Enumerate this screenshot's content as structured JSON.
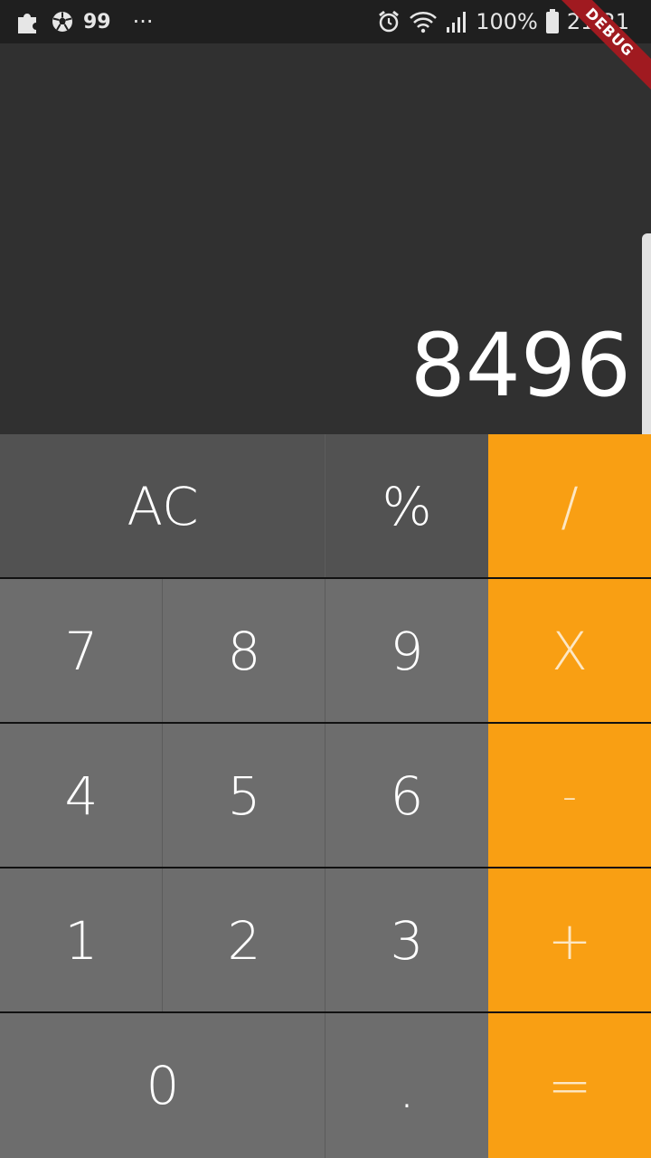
{
  "status_bar": {
    "notification_count": "99",
    "more": "···",
    "battery": "100%",
    "time": "21:21"
  },
  "ribbon": {
    "label": "DEBUG"
  },
  "display": {
    "value": "8496"
  },
  "keys": {
    "clear": "AC",
    "percent": "%",
    "divide": "/",
    "seven": "7",
    "eight": "8",
    "nine": "9",
    "multiply": "X",
    "four": "4",
    "five": "5",
    "six": "6",
    "subtract": "-",
    "one": "1",
    "two": "2",
    "three": "3",
    "add": "+",
    "zero": "0",
    "decimal": ".",
    "equals": "="
  }
}
